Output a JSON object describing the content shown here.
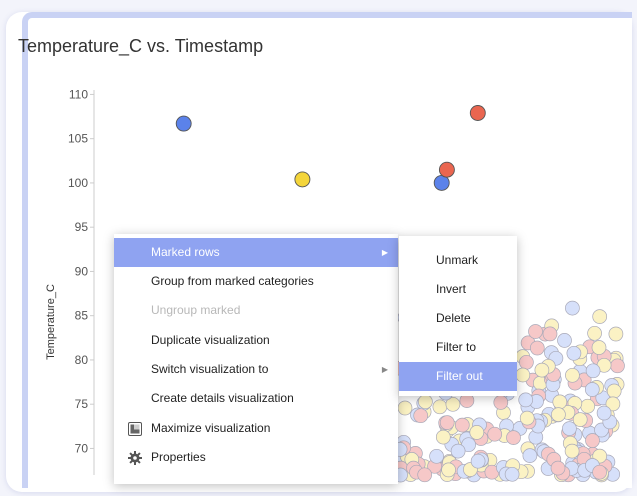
{
  "chart_data": {
    "type": "scatter",
    "title": "Temperature_C vs. Timestamp",
    "xlabel": "",
    "ylabel": "Temperature_C",
    "yticks": [
      110,
      105,
      100,
      95,
      90,
      85,
      80,
      75,
      70
    ],
    "ylim": [
      67,
      110.5
    ],
    "grid": false,
    "series": [
      {
        "color": "#5b82ea",
        "points": [
          [
            0.17,
            106.7
          ],
          [
            0.67,
            100.0
          ]
        ]
      },
      {
        "color": "#f4d53a",
        "points": [
          [
            0.4,
            100.4
          ]
        ]
      },
      {
        "color": "#ea6650",
        "points": [
          [
            0.68,
            101.5
          ],
          [
            0.74,
            107.9
          ]
        ]
      }
    ],
    "cluster": {
      "colors": [
        "#f6c8c8",
        "#d6e0fa",
        "#fbf2c4"
      ],
      "y_range": [
        67,
        86
      ]
    }
  },
  "context_menu": {
    "items": [
      {
        "label": "Marked rows",
        "state": "active",
        "submenu": true
      },
      {
        "label": "Group from marked categories",
        "state": "normal"
      },
      {
        "label": "Ungroup marked",
        "state": "disabled"
      },
      {
        "label": "Duplicate visualization",
        "state": "normal"
      },
      {
        "label": "Switch visualization to",
        "state": "normal",
        "submenu": true
      },
      {
        "label": "Create details visualization",
        "state": "normal"
      },
      {
        "label": "Maximize visualization",
        "state": "normal",
        "icon": "maximize-icon"
      },
      {
        "label": "Properties",
        "state": "normal",
        "icon": "gear-icon"
      }
    ]
  },
  "submenu": {
    "items": [
      {
        "label": "Unmark",
        "state": "normal"
      },
      {
        "label": "Invert",
        "state": "normal"
      },
      {
        "label": "Delete",
        "state": "normal"
      },
      {
        "label": "Filter to",
        "state": "normal"
      },
      {
        "label": "Filter out",
        "state": "active"
      }
    ]
  },
  "colors": {
    "menu_highlight": "#8fa3f1",
    "frame_accent": "#c9d2f4"
  }
}
